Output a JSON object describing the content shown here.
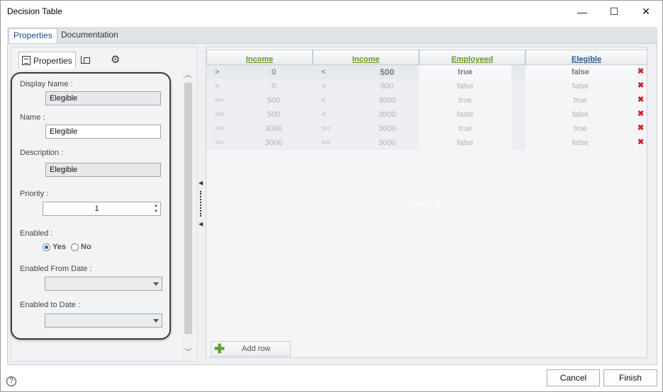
{
  "window": {
    "title": "Decision Table",
    "minimize": "—",
    "maximize": "☐",
    "close": "✕"
  },
  "tabs": [
    {
      "label": "Properties"
    },
    {
      "label": "Documentation"
    }
  ],
  "left": {
    "subtabs": {
      "properties": "Properties"
    },
    "display_name": {
      "label": "Display Name :",
      "value": "Elegible"
    },
    "name": {
      "label": "Name :",
      "value": "Elegible"
    },
    "description": {
      "label": "Description :",
      "value": "Elegible"
    },
    "priority": {
      "label": "Priority :",
      "value": "1"
    },
    "enabled": {
      "label": "Enabled :",
      "yes": "Yes",
      "no": "No",
      "selected": "Yes"
    },
    "enabled_from": {
      "label": "Enabled From Date :",
      "value": ""
    },
    "enabled_to": {
      "label": "Enabled to Date :",
      "value": ""
    }
  },
  "grid": {
    "headers": [
      {
        "label": "Income",
        "color": "#6a9a1f"
      },
      {
        "label": "Income",
        "color": "#6a9a1f"
      },
      {
        "label": "Employeed",
        "color": "#6a9a1f"
      },
      {
        "label": "Elegible",
        "color": "#2d5b8e"
      }
    ],
    "rows": [
      [
        ">",
        "0",
        "<",
        "500",
        "true",
        "false"
      ],
      [
        ">",
        "0",
        "<",
        "500",
        "false",
        "false"
      ],
      [
        ">=",
        "500",
        "<",
        "3000",
        "true",
        "true"
      ],
      [
        ">=",
        "500",
        "<",
        "3000",
        "false",
        "false"
      ],
      [
        ">=",
        "3000",
        ">=",
        "3000",
        "true",
        "true"
      ],
      [
        ">=",
        "3000",
        ">=",
        "3000",
        "false",
        "false"
      ]
    ],
    "delete_glyph": "✖",
    "watermark": "panel1.r1",
    "add_row": "Add row"
  },
  "footer": {
    "help": "?",
    "cancel": "Cancel",
    "finish": "Finish"
  },
  "colors": {
    "input_header": "#6a9a1f",
    "output_header": "#2d5b8e",
    "delete": "#d0202a",
    "add_icon": "#5aa02c"
  }
}
